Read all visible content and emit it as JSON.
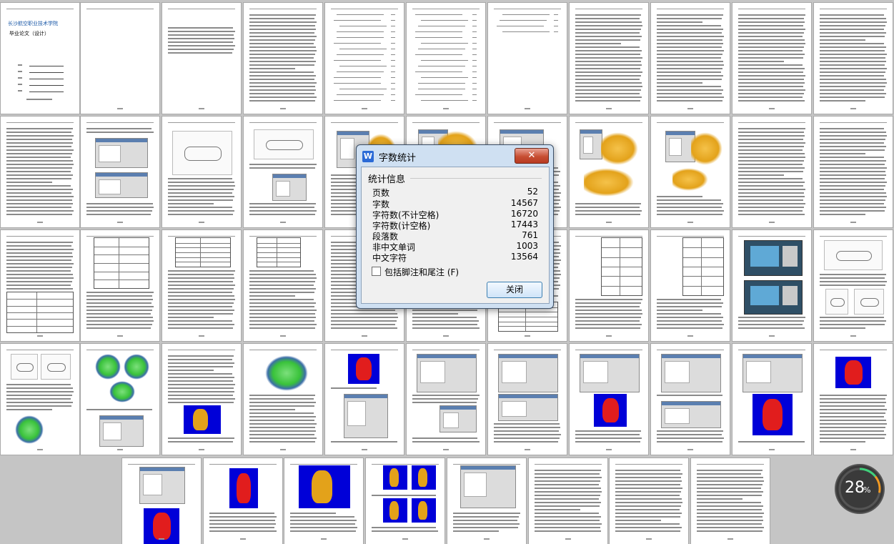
{
  "dialog": {
    "title": "字数统计",
    "close_glyph": "✕",
    "group_title": "统计信息",
    "stats": [
      {
        "label": "页数",
        "value": "52"
      },
      {
        "label": "字数",
        "value": "14567"
      },
      {
        "label": "字符数(不计空格)",
        "value": "16720"
      },
      {
        "label": "字符数(计空格)",
        "value": "17443"
      },
      {
        "label": "段落数",
        "value": "761"
      },
      {
        "label": "非中文单词",
        "value": "1003"
      },
      {
        "label": "中文字符",
        "value": "13564"
      }
    ],
    "checkbox_label": "包括脚注和尾注 (F)",
    "checkbox_checked": false,
    "close_button_label": "关闭",
    "app_icon": "W"
  },
  "document": {
    "cover_school": "长沙航空职业技术学院",
    "cover_title": "毕业论文（设计）",
    "page_count": 52
  },
  "zoom": {
    "value": "28",
    "unit": "%",
    "colors": {
      "track": "#3a3a3a",
      "arc_green": "#3fd07a",
      "arc_orange": "#f29a22"
    }
  },
  "colors": {
    "workspace_bg": "#c5c5c5",
    "model_blue_bg": "#0000d8",
    "model_red": "#e11d1d",
    "model_yellow": "#e3a21a",
    "model_green": "#39c23a"
  }
}
